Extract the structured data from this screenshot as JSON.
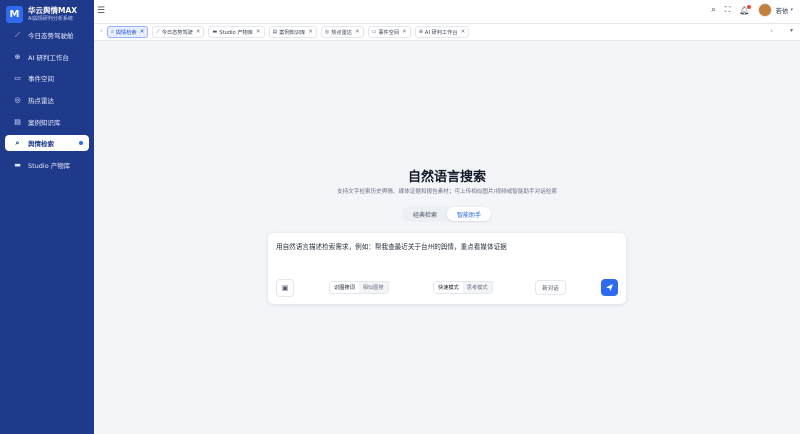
{
  "brand": {
    "logo_letter": "M",
    "name": "华云舆情MAX",
    "subtitle": "AI舆情研判分析系统"
  },
  "sidebar": {
    "items": [
      {
        "label": "今日态势驾驶舱",
        "icon": "trend-chart-icon",
        "glyph": "⟋"
      },
      {
        "label": "AI 研判工作台",
        "icon": "globe-icon",
        "glyph": "⊕"
      },
      {
        "label": "事件空间",
        "icon": "folder-icon",
        "glyph": "▭"
      },
      {
        "label": "热点雷达",
        "icon": "radar-icon",
        "glyph": "◎"
      },
      {
        "label": "案例知识库",
        "icon": "book-icon",
        "glyph": "▤"
      },
      {
        "label": "舆情检索",
        "icon": "search-icon",
        "glyph": "⌕",
        "active": true
      },
      {
        "label": "Studio 产物库",
        "icon": "archive-icon",
        "glyph": "▬"
      }
    ]
  },
  "topbar": {
    "user_name": "若依"
  },
  "tabs": [
    {
      "label": "舆情检索",
      "icon": "search-icon",
      "glyph": "⌕",
      "active": true
    },
    {
      "label": "今日态势驾驶",
      "icon": "trend-chart-icon",
      "glyph": "⟋"
    },
    {
      "label": "Studio 产物库",
      "icon": "archive-icon",
      "glyph": "▬"
    },
    {
      "label": "案例知识库",
      "icon": "book-icon",
      "glyph": "▤"
    },
    {
      "label": "热点雷达",
      "icon": "radar-icon",
      "glyph": "◎"
    },
    {
      "label": "事件空间",
      "icon": "folder-icon",
      "glyph": "▭"
    },
    {
      "label": "AI 研判工作台",
      "icon": "globe-icon",
      "glyph": "⊕"
    }
  ],
  "search": {
    "title": "自然语言搜索",
    "subtitle": "支持文字检索历史舆情、媒体证据和报告素材；可上传相似图片/视频或智能助手对话检索",
    "modes": {
      "classic": "经典检索",
      "assistant": "智能助手",
      "active": "assistant"
    },
    "query": "用自然语言描述检索需求，例如：帮我查最近关于台州的舆情，重点看媒体证据",
    "image_seg": {
      "on": "识图搜词",
      "off": "相似图搜"
    },
    "speed_seg": {
      "on": "快速模式",
      "off": "思考模式"
    },
    "new_chat": "新对话"
  },
  "colors": {
    "sidebar": "#1f3a8a",
    "accent": "#2f6bf0",
    "background": "#f3f5f9"
  }
}
